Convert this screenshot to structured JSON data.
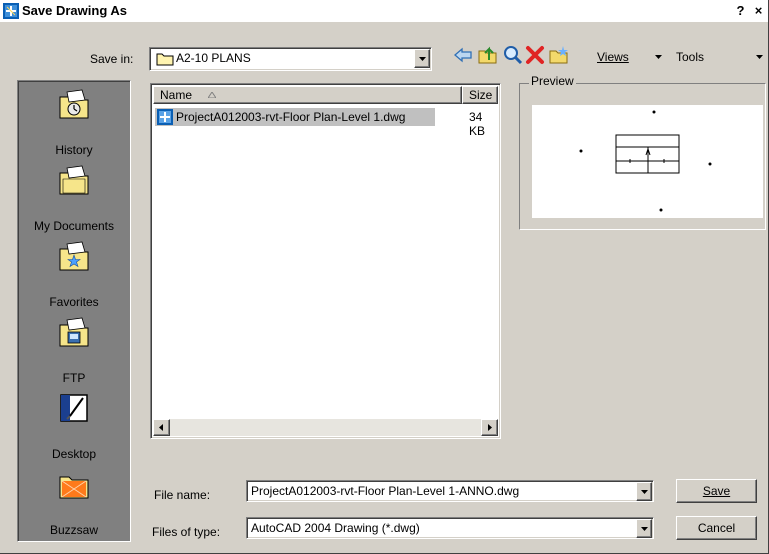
{
  "window": {
    "title": "Save Drawing As",
    "help_button": "?",
    "close_button": "×"
  },
  "toolbar": {
    "save_in_label": "Save in:",
    "save_in_value": "A2-10 PLANS",
    "views_label": "Views",
    "tools_label": "Tools"
  },
  "places": [
    {
      "label": "History",
      "icon": "history-folder-icon"
    },
    {
      "label": "My Documents",
      "icon": "my-documents-folder-icon"
    },
    {
      "label": "Favorites",
      "icon": "favorites-folder-icon"
    },
    {
      "label": "FTP",
      "icon": "ftp-folder-icon"
    },
    {
      "label": "Desktop",
      "icon": "desktop-icon"
    },
    {
      "label": "Buzzsaw",
      "icon": "buzzsaw-folder-icon"
    }
  ],
  "file_list": {
    "columns": [
      "Name",
      "Size"
    ],
    "files": [
      {
        "name": "ProjectA012003-rvt-Floor Plan-Level 1.dwg",
        "size": "34 KB"
      }
    ]
  },
  "preview": {
    "label": "Preview"
  },
  "form": {
    "file_name_label": "File name:",
    "file_name_value": "ProjectA012003-rvt-Floor Plan-Level 1-ANNO.dwg",
    "files_of_type_label": "Files of type:",
    "files_of_type_value": "AutoCAD 2004 Drawing (*.dwg)",
    "save_label": "Save",
    "cancel_label": "Cancel"
  },
  "colors": {
    "dialog_face": "#d4d0c8",
    "selection": "#c0c0c0",
    "places_bar": "#808080"
  }
}
